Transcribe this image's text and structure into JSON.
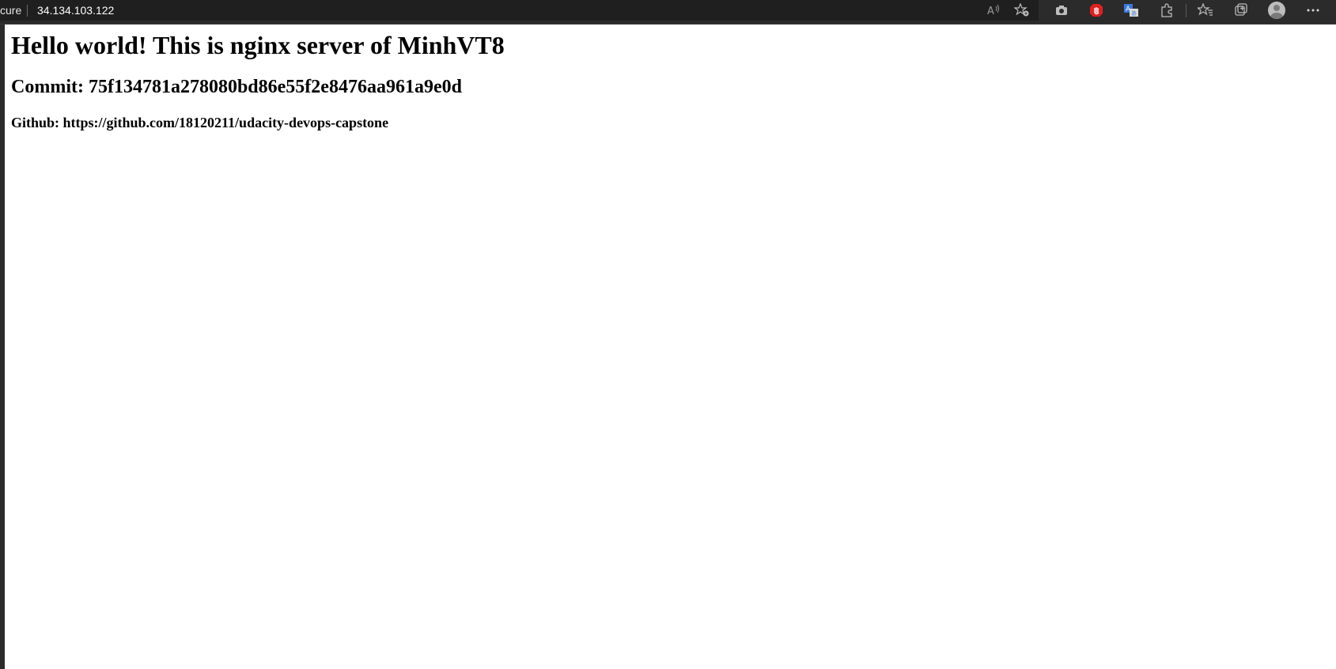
{
  "browser": {
    "security_text": "cure",
    "url": "34.134.103.122",
    "icons": [
      "read-aloud-icon",
      "favorite-add-icon",
      "screenshot-icon",
      "adblock-icon",
      "translate-icon",
      "extensions-icon",
      "favorites-icon",
      "collections-icon",
      "profile-icon",
      "more-icon"
    ],
    "colors": {
      "toolbar_bg": "#2b2b2b",
      "address_bg": "#1f1f1f",
      "adblock_red": "#e02020",
      "translate_blue": "#3a78d8"
    }
  },
  "page": {
    "heading": "Hello world! This is nginx server of MinhVT8",
    "commit": "Commit: 75f134781a278080bd86e55f2e8476aa961a9e0d",
    "github": "Github: https://github.com/18120211/udacity-devops-capstone"
  }
}
